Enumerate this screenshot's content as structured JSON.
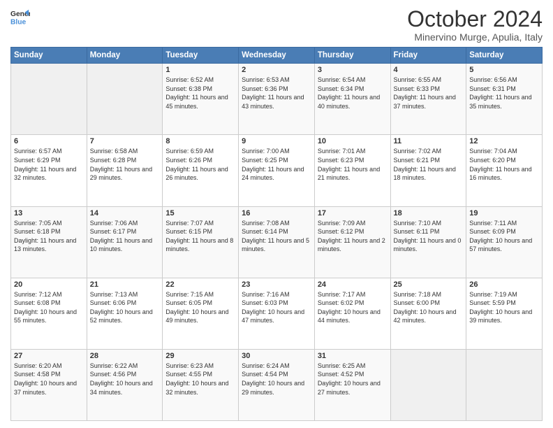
{
  "header": {
    "logo_general": "General",
    "logo_blue": "Blue",
    "month_title": "October 2024",
    "location": "Minervino Murge, Apulia, Italy"
  },
  "weekdays": [
    "Sunday",
    "Monday",
    "Tuesday",
    "Wednesday",
    "Thursday",
    "Friday",
    "Saturday"
  ],
  "weeks": [
    [
      {
        "day": "",
        "sunrise": "",
        "sunset": "",
        "daylight": ""
      },
      {
        "day": "",
        "sunrise": "",
        "sunset": "",
        "daylight": ""
      },
      {
        "day": "1",
        "sunrise": "Sunrise: 6:52 AM",
        "sunset": "Sunset: 6:38 PM",
        "daylight": "Daylight: 11 hours and 45 minutes."
      },
      {
        "day": "2",
        "sunrise": "Sunrise: 6:53 AM",
        "sunset": "Sunset: 6:36 PM",
        "daylight": "Daylight: 11 hours and 43 minutes."
      },
      {
        "day": "3",
        "sunrise": "Sunrise: 6:54 AM",
        "sunset": "Sunset: 6:34 PM",
        "daylight": "Daylight: 11 hours and 40 minutes."
      },
      {
        "day": "4",
        "sunrise": "Sunrise: 6:55 AM",
        "sunset": "Sunset: 6:33 PM",
        "daylight": "Daylight: 11 hours and 37 minutes."
      },
      {
        "day": "5",
        "sunrise": "Sunrise: 6:56 AM",
        "sunset": "Sunset: 6:31 PM",
        "daylight": "Daylight: 11 hours and 35 minutes."
      }
    ],
    [
      {
        "day": "6",
        "sunrise": "Sunrise: 6:57 AM",
        "sunset": "Sunset: 6:29 PM",
        "daylight": "Daylight: 11 hours and 32 minutes."
      },
      {
        "day": "7",
        "sunrise": "Sunrise: 6:58 AM",
        "sunset": "Sunset: 6:28 PM",
        "daylight": "Daylight: 11 hours and 29 minutes."
      },
      {
        "day": "8",
        "sunrise": "Sunrise: 6:59 AM",
        "sunset": "Sunset: 6:26 PM",
        "daylight": "Daylight: 11 hours and 26 minutes."
      },
      {
        "day": "9",
        "sunrise": "Sunrise: 7:00 AM",
        "sunset": "Sunset: 6:25 PM",
        "daylight": "Daylight: 11 hours and 24 minutes."
      },
      {
        "day": "10",
        "sunrise": "Sunrise: 7:01 AM",
        "sunset": "Sunset: 6:23 PM",
        "daylight": "Daylight: 11 hours and 21 minutes."
      },
      {
        "day": "11",
        "sunrise": "Sunrise: 7:02 AM",
        "sunset": "Sunset: 6:21 PM",
        "daylight": "Daylight: 11 hours and 18 minutes."
      },
      {
        "day": "12",
        "sunrise": "Sunrise: 7:04 AM",
        "sunset": "Sunset: 6:20 PM",
        "daylight": "Daylight: 11 hours and 16 minutes."
      }
    ],
    [
      {
        "day": "13",
        "sunrise": "Sunrise: 7:05 AM",
        "sunset": "Sunset: 6:18 PM",
        "daylight": "Daylight: 11 hours and 13 minutes."
      },
      {
        "day": "14",
        "sunrise": "Sunrise: 7:06 AM",
        "sunset": "Sunset: 6:17 PM",
        "daylight": "Daylight: 11 hours and 10 minutes."
      },
      {
        "day": "15",
        "sunrise": "Sunrise: 7:07 AM",
        "sunset": "Sunset: 6:15 PM",
        "daylight": "Daylight: 11 hours and 8 minutes."
      },
      {
        "day": "16",
        "sunrise": "Sunrise: 7:08 AM",
        "sunset": "Sunset: 6:14 PM",
        "daylight": "Daylight: 11 hours and 5 minutes."
      },
      {
        "day": "17",
        "sunrise": "Sunrise: 7:09 AM",
        "sunset": "Sunset: 6:12 PM",
        "daylight": "Daylight: 11 hours and 2 minutes."
      },
      {
        "day": "18",
        "sunrise": "Sunrise: 7:10 AM",
        "sunset": "Sunset: 6:11 PM",
        "daylight": "Daylight: 11 hours and 0 minutes."
      },
      {
        "day": "19",
        "sunrise": "Sunrise: 7:11 AM",
        "sunset": "Sunset: 6:09 PM",
        "daylight": "Daylight: 10 hours and 57 minutes."
      }
    ],
    [
      {
        "day": "20",
        "sunrise": "Sunrise: 7:12 AM",
        "sunset": "Sunset: 6:08 PM",
        "daylight": "Daylight: 10 hours and 55 minutes."
      },
      {
        "day": "21",
        "sunrise": "Sunrise: 7:13 AM",
        "sunset": "Sunset: 6:06 PM",
        "daylight": "Daylight: 10 hours and 52 minutes."
      },
      {
        "day": "22",
        "sunrise": "Sunrise: 7:15 AM",
        "sunset": "Sunset: 6:05 PM",
        "daylight": "Daylight: 10 hours and 49 minutes."
      },
      {
        "day": "23",
        "sunrise": "Sunrise: 7:16 AM",
        "sunset": "Sunset: 6:03 PM",
        "daylight": "Daylight: 10 hours and 47 minutes."
      },
      {
        "day": "24",
        "sunrise": "Sunrise: 7:17 AM",
        "sunset": "Sunset: 6:02 PM",
        "daylight": "Daylight: 10 hours and 44 minutes."
      },
      {
        "day": "25",
        "sunrise": "Sunrise: 7:18 AM",
        "sunset": "Sunset: 6:00 PM",
        "daylight": "Daylight: 10 hours and 42 minutes."
      },
      {
        "day": "26",
        "sunrise": "Sunrise: 7:19 AM",
        "sunset": "Sunset: 5:59 PM",
        "daylight": "Daylight: 10 hours and 39 minutes."
      }
    ],
    [
      {
        "day": "27",
        "sunrise": "Sunrise: 6:20 AM",
        "sunset": "Sunset: 4:58 PM",
        "daylight": "Daylight: 10 hours and 37 minutes."
      },
      {
        "day": "28",
        "sunrise": "Sunrise: 6:22 AM",
        "sunset": "Sunset: 4:56 PM",
        "daylight": "Daylight: 10 hours and 34 minutes."
      },
      {
        "day": "29",
        "sunrise": "Sunrise: 6:23 AM",
        "sunset": "Sunset: 4:55 PM",
        "daylight": "Daylight: 10 hours and 32 minutes."
      },
      {
        "day": "30",
        "sunrise": "Sunrise: 6:24 AM",
        "sunset": "Sunset: 4:54 PM",
        "daylight": "Daylight: 10 hours and 29 minutes."
      },
      {
        "day": "31",
        "sunrise": "Sunrise: 6:25 AM",
        "sunset": "Sunset: 4:52 PM",
        "daylight": "Daylight: 10 hours and 27 minutes."
      },
      {
        "day": "",
        "sunrise": "",
        "sunset": "",
        "daylight": ""
      },
      {
        "day": "",
        "sunrise": "",
        "sunset": "",
        "daylight": ""
      }
    ]
  ]
}
